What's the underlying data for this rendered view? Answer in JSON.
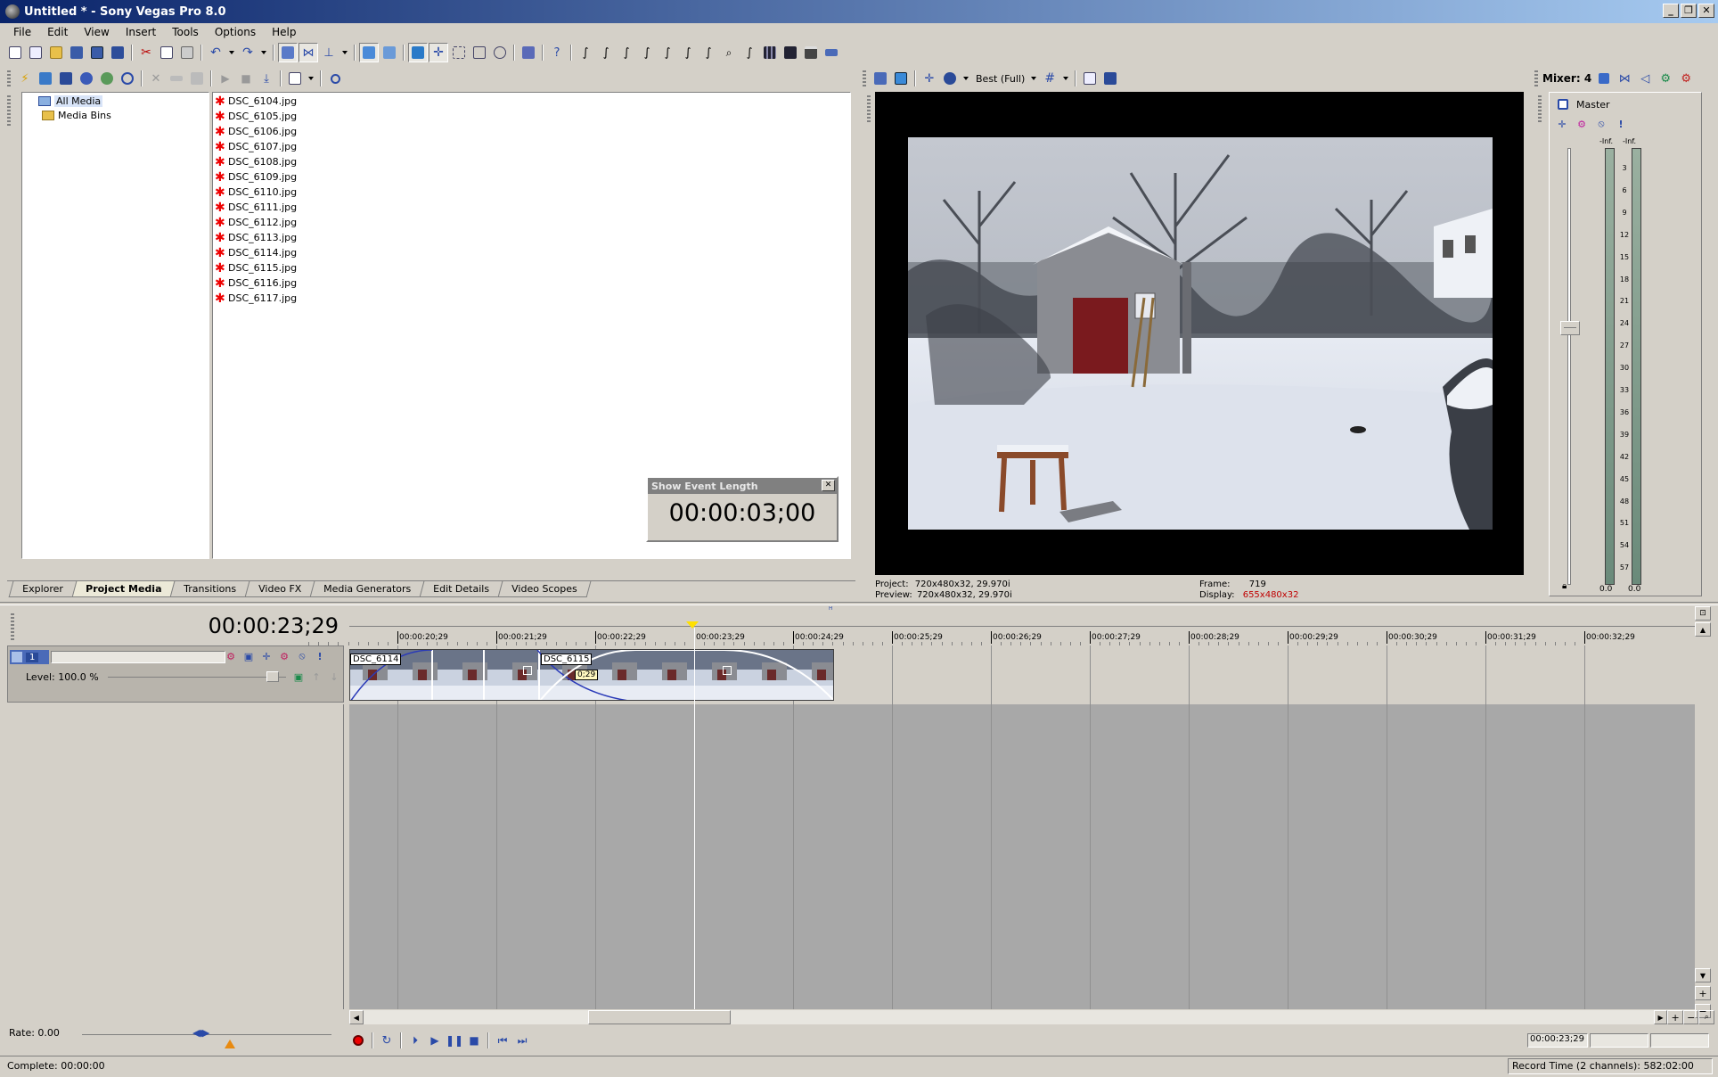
{
  "window": {
    "title": "Untitled * - Sony Vegas Pro 8.0",
    "min": "_",
    "max": "❐",
    "close": "✕"
  },
  "menu": [
    "File",
    "Edit",
    "View",
    "Insert",
    "Tools",
    "Options",
    "Help"
  ],
  "explorer": {
    "tree": [
      "All Media",
      "Media Bins"
    ],
    "files": [
      "DSC_6104.jpg",
      "DSC_6105.jpg",
      "DSC_6106.jpg",
      "DSC_6107.jpg",
      "DSC_6108.jpg",
      "DSC_6109.jpg",
      "DSC_6110.jpg",
      "DSC_6111.jpg",
      "DSC_6112.jpg",
      "DSC_6113.jpg",
      "DSC_6114.jpg",
      "DSC_6115.jpg",
      "DSC_6116.jpg",
      "DSC_6117.jpg"
    ],
    "tabs": [
      "Explorer",
      "Project Media",
      "Transitions",
      "Video FX",
      "Media Generators",
      "Edit Details",
      "Video Scopes"
    ],
    "active_tab": "Project Media"
  },
  "event_length": {
    "title": "Show Event Length",
    "value": "00:00:03;00",
    "close": "✕"
  },
  "preview": {
    "quality": "Best (Full)",
    "project_label": "Project:",
    "project_value": "720x480x32, 29.970i",
    "preview_label": "Preview:",
    "preview_value": "720x480x32, 29.970i",
    "frame_label": "Frame:",
    "frame_value": "719",
    "display_label": "Display:",
    "display_value": "655x480x32"
  },
  "mixer": {
    "title": "Mixer: 4",
    "master": "Master",
    "peak_left": "-Inf.",
    "peak_right": "-Inf.",
    "scale": [
      "3",
      "6",
      "9",
      "12",
      "15",
      "18",
      "21",
      "24",
      "27",
      "30",
      "33",
      "36",
      "39",
      "42",
      "45",
      "48",
      "51",
      "54",
      "57"
    ],
    "bottom_left": "0.0",
    "bottom_right": "0.0"
  },
  "timeline": {
    "timecode": "00:00:23;29",
    "ruler": [
      "00:00:20;29",
      "00:00:21;29",
      "00:00:22;29",
      "00:00:23;29",
      "00:00:24;29",
      "00:00:25;29",
      "00:00:26;29",
      "00:00:27;29",
      "00:00:28;29",
      "00:00:29;29",
      "00:00:30;29",
      "00:00:31;29",
      "00:00:32;29"
    ],
    "track_number": "1",
    "level": "Level: 100.0 %",
    "clip1": "DSC_6114",
    "clip2": "DSC_6115",
    "crossfade": "0;29",
    "rate": "Rate: 0.00",
    "position": "00:00:23;29"
  },
  "status": {
    "complete": "Complete: 00:00:00",
    "record": "Record Time (2 channels): 582:02:00"
  },
  "colors": {
    "title_start": "#0a246a",
    "title_end": "#a6caf0",
    "display_value": "#c00000",
    "cursor": "#ffe000"
  }
}
